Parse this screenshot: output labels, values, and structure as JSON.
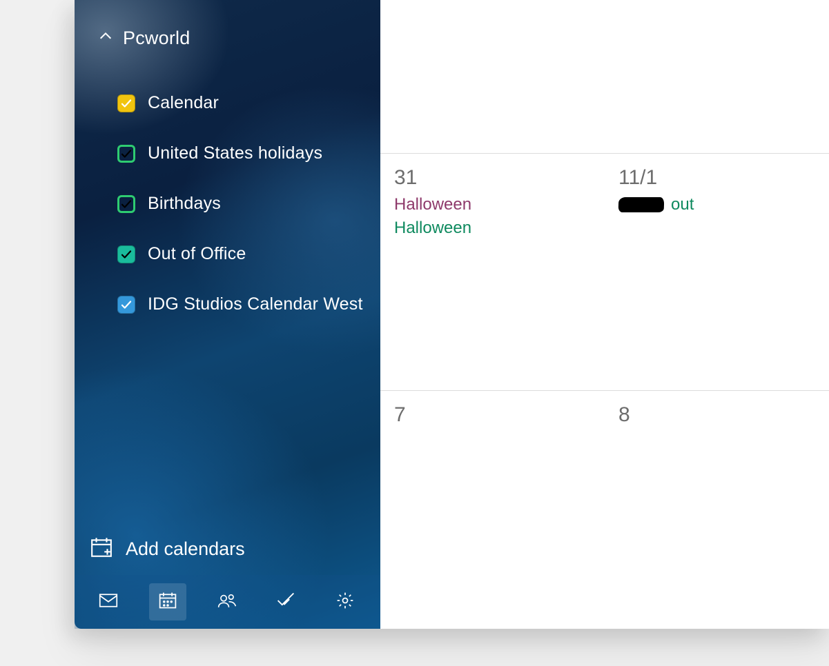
{
  "sidebar": {
    "account_label": "Pcworld",
    "calendars": [
      {
        "label": "Calendar",
        "color": "#f1c40f",
        "style": "solid",
        "check": "white"
      },
      {
        "label": "United States holidays",
        "color": "#2ecc71",
        "style": "hollow",
        "check": "white"
      },
      {
        "label": "Birthdays",
        "color": "#2ecc71",
        "style": "hollow",
        "check": "white"
      },
      {
        "label": "Out of Office",
        "color": "#1abc9c",
        "style": "solid",
        "check": "black"
      },
      {
        "label": "IDG Studios Calendar West",
        "color": "#3498db",
        "style": "solid",
        "check": "white"
      }
    ],
    "add_calendars_label": "Add calendars"
  },
  "bottom_icons": {
    "mail": "mail-icon",
    "calendar": "calendar-icon",
    "people": "people-icon",
    "todo": "todo-icon",
    "settings": "gear-icon"
  },
  "grid": {
    "rows": [
      {
        "cells": [
          {
            "day": "",
            "events": []
          },
          {
            "day": "",
            "events": []
          }
        ]
      },
      {
        "cells": [
          {
            "day": "31",
            "events": [
              {
                "text": "Halloween",
                "color": "#8e3a6b"
              },
              {
                "text": "Halloween",
                "color": "#0f8a5f"
              }
            ]
          },
          {
            "day": "11/1",
            "events": [
              {
                "text": "out",
                "color": "#0f8a5f",
                "redacted": true
              }
            ]
          }
        ]
      },
      {
        "cells": [
          {
            "day": "7",
            "events": []
          },
          {
            "day": "8",
            "events": []
          }
        ]
      }
    ]
  }
}
